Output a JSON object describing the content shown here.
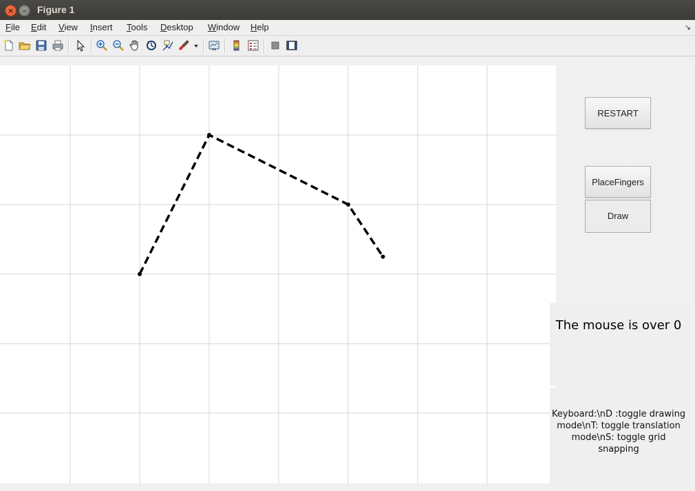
{
  "window": {
    "title": "Figure 1",
    "close_glyph": "×",
    "minimize_glyph": "–"
  },
  "menubar": {
    "items": [
      {
        "mnemonic": "F",
        "rest": "ile"
      },
      {
        "mnemonic": "E",
        "rest": "dit"
      },
      {
        "mnemonic": "V",
        "rest": "iew"
      },
      {
        "mnemonic": "I",
        "rest": "nsert"
      },
      {
        "mnemonic": "T",
        "rest": "ools"
      },
      {
        "mnemonic": "D",
        "rest": "esktop"
      },
      {
        "mnemonic": "W",
        "rest": "indow"
      },
      {
        "mnemonic": "H",
        "rest": "elp"
      }
    ],
    "overflow_glyph": "↘"
  },
  "toolbar": {
    "icons": [
      "new-figure-icon",
      "open-file-icon",
      "save-icon",
      "print-icon",
      "edit-plot-arrow-icon",
      "zoom-in-icon",
      "zoom-out-icon",
      "pan-hand-icon",
      "rotate-3d-icon",
      "data-cursor-icon",
      "brush-icon",
      "brush-dropdown-icon",
      "link-plot-icon",
      "colorbar-icon",
      "legend-icon",
      "hide-plot-tools-icon",
      "show-plot-tools-icon"
    ]
  },
  "buttons": {
    "restart": "RESTART",
    "place_fingers": "PlaceFingers",
    "draw": "Draw"
  },
  "status": {
    "text": "The mouse is over 0"
  },
  "help": {
    "line1": "Keyboard:\\nD :toggle drawing",
    "line2": "mode\\nT: toggle translation",
    "line3": "mode\\nS: toggle grid snapping"
  },
  "plot": {
    "grid": true,
    "x_range": [
      0,
      8
    ],
    "y_range": [
      0,
      6
    ],
    "line_style": "dashed",
    "line_color": "#000000",
    "grid_color": "#d4d4d4",
    "points": [
      {
        "x": 2.0,
        "y": 3.0
      },
      {
        "x": 3.0,
        "y": 5.0
      },
      {
        "x": 5.0,
        "y": 4.0
      },
      {
        "x": 5.5,
        "y": 3.25
      }
    ]
  }
}
